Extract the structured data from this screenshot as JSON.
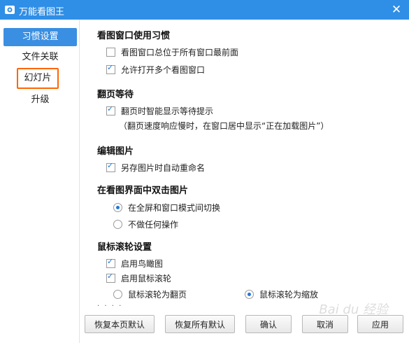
{
  "window": {
    "title": "万能看图王",
    "close_glyph": "✕"
  },
  "sidebar": {
    "items": [
      {
        "label": "习惯设置"
      },
      {
        "label": "文件关联"
      },
      {
        "label": "幻灯片"
      },
      {
        "label": "升级"
      }
    ]
  },
  "sections": {
    "habits": {
      "title": "看图窗口使用习惯",
      "opt1": "看图窗口总位于所有窗口最前面",
      "opt2": "允许打开多个看图窗口"
    },
    "pageturn": {
      "title": "翻页等待",
      "opt1": "翻页时智能显示等待提示",
      "note": "（翻页速度响应慢时，在窗口居中显示“正在加载图片”）"
    },
    "edit": {
      "title": "编辑图片",
      "opt1": "另存图片时自动重命名"
    },
    "dblclick": {
      "title": "在看图界面中双击图片",
      "opt1": "在全屏和窗口模式间切换",
      "opt2": "不做任何操作"
    },
    "wheel": {
      "title": "鼠标滚轮设置",
      "opt1": "启用鸟瞰图",
      "opt2": "启用鼠标滚轮",
      "radio1": "鼠标滚轮为翻页",
      "radio2": "鼠标滚轮为缩放"
    },
    "more_dots": "· · · ·"
  },
  "buttons": {
    "restore_page": "恢复本页默认",
    "restore_all": "恢复所有默认",
    "ok": "确认",
    "cancel": "取消",
    "apply": "应用"
  },
  "watermark": "Bai du 经验"
}
